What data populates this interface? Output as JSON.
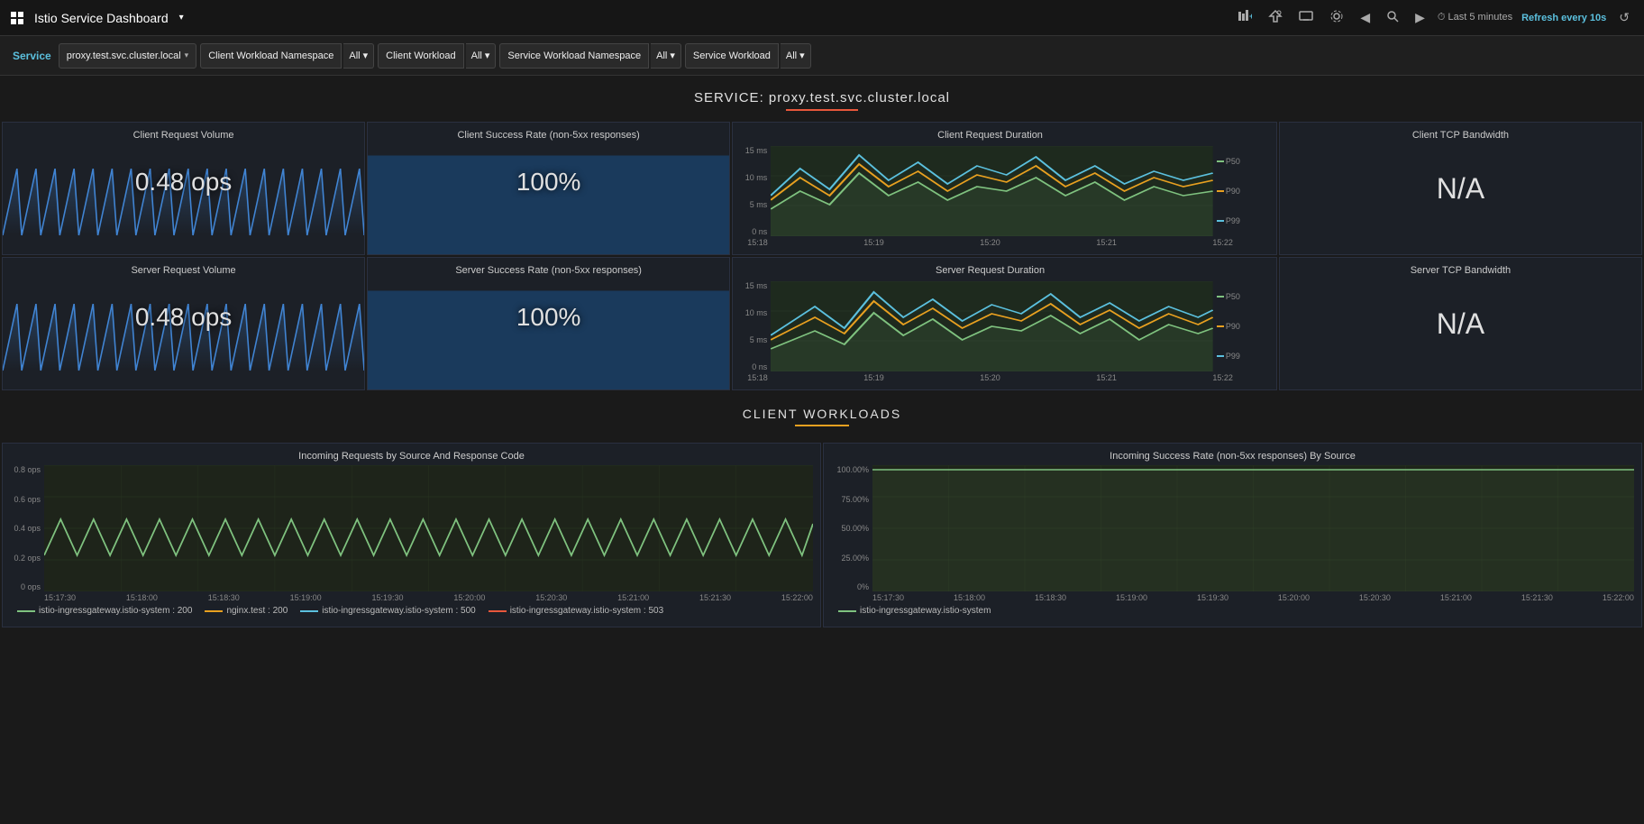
{
  "topBar": {
    "title": "Istio Service Dashboard",
    "timeLabel": "Last 5 minutes",
    "refreshLabel": "Refresh every 10s",
    "icons": [
      "bar-chart-add",
      "share",
      "tv",
      "gear",
      "chevron-left",
      "search",
      "chevron-right",
      "clock",
      "refresh"
    ]
  },
  "filterBar": {
    "serviceLabel": "Service",
    "serviceValue": "proxy.test.svc.cluster.local",
    "clientWorkloadNsLabel": "Client Workload Namespace",
    "clientWorkloadNsValue": "All",
    "clientWorkloadLabel": "Client Workload",
    "clientWorkloadValue": "All",
    "serviceWorkloadNsLabel": "Service Workload Namespace",
    "serviceWorkloadNsValue": "All",
    "serviceWorkloadLabel": "Service Workload",
    "serviceWorkloadValue": "All"
  },
  "serviceSection": {
    "title": "SERVICE: proxy.test.svc.cluster.local"
  },
  "clientRow": {
    "requestVolume": {
      "title": "Client Request Volume",
      "value": "0.48 ops"
    },
    "successRate": {
      "title": "Client Success Rate (non-5xx responses)",
      "value": "100%"
    },
    "requestDuration": {
      "title": "Client Request Duration",
      "yLabels": [
        "15 ms",
        "10 ms",
        "5 ms",
        "0 ns"
      ],
      "xLabels": [
        "15:18",
        "15:19",
        "15:20",
        "15:21",
        "15:22"
      ],
      "legends": [
        {
          "label": "P50",
          "color": "#7fc27f"
        },
        {
          "label": "P90",
          "color": "#e8a020"
        },
        {
          "label": "P99",
          "color": "#5bc0de"
        }
      ]
    },
    "tcpBandwidth": {
      "title": "Client TCP Bandwidth",
      "value": "N/A"
    }
  },
  "serverRow": {
    "requestVolume": {
      "title": "Server Request Volume",
      "value": "0.48 ops"
    },
    "successRate": {
      "title": "Server Success Rate (non-5xx responses)",
      "value": "100%"
    },
    "requestDuration": {
      "title": "Server Request Duration",
      "yLabels": [
        "15 ms",
        "10 ms",
        "5 ms",
        "0 ns"
      ],
      "xLabels": [
        "15:18",
        "15:19",
        "15:20",
        "15:21",
        "15:22"
      ],
      "legends": [
        {
          "label": "P50",
          "color": "#7fc27f"
        },
        {
          "label": "P90",
          "color": "#e8a020"
        },
        {
          "label": "P99",
          "color": "#5bc0de"
        }
      ]
    },
    "tcpBandwidth": {
      "title": "Server TCP Bandwidth",
      "value": "N/A"
    }
  },
  "clientWorkloads": {
    "title": "CLIENT WORKLOADS",
    "incomingRequests": {
      "title": "Incoming Requests by Source And Response Code",
      "yLabels": [
        "0.8 ops",
        "0.6 ops",
        "0.4 ops",
        "0.2 ops",
        "0 ops"
      ],
      "xLabels": [
        "15:17:30",
        "15:18:00",
        "15:18:30",
        "15:19:00",
        "15:19:30",
        "15:20:00",
        "15:20:30",
        "15:21:00",
        "15:21:30",
        "15:22:00"
      ],
      "legends": [
        {
          "label": "istio-ingressgateway.istio-system : 200",
          "color": "#7fc27f"
        },
        {
          "label": "nginx.test : 200",
          "color": "#e8a020"
        },
        {
          "label": "istio-ingressgateway.istio-system : 500",
          "color": "#5bc0de"
        },
        {
          "label": "istio-ingressgateway.istio-system : 503",
          "color": "#e8573b"
        }
      ]
    },
    "successRate": {
      "title": "Incoming Success Rate (non-5xx responses) By Source",
      "yLabels": [
        "100.00%",
        "75.00%",
        "50.00%",
        "25.00%",
        "0%"
      ],
      "xLabels": [
        "15:17:30",
        "15:18:00",
        "15:18:30",
        "15:19:00",
        "15:19:30",
        "15:20:00",
        "15:20:30",
        "15:21:00",
        "15:21:30",
        "15:22:00"
      ],
      "legends": [
        {
          "label": "istio-ingressgateway.istio-system",
          "color": "#7fc27f"
        }
      ]
    }
  }
}
